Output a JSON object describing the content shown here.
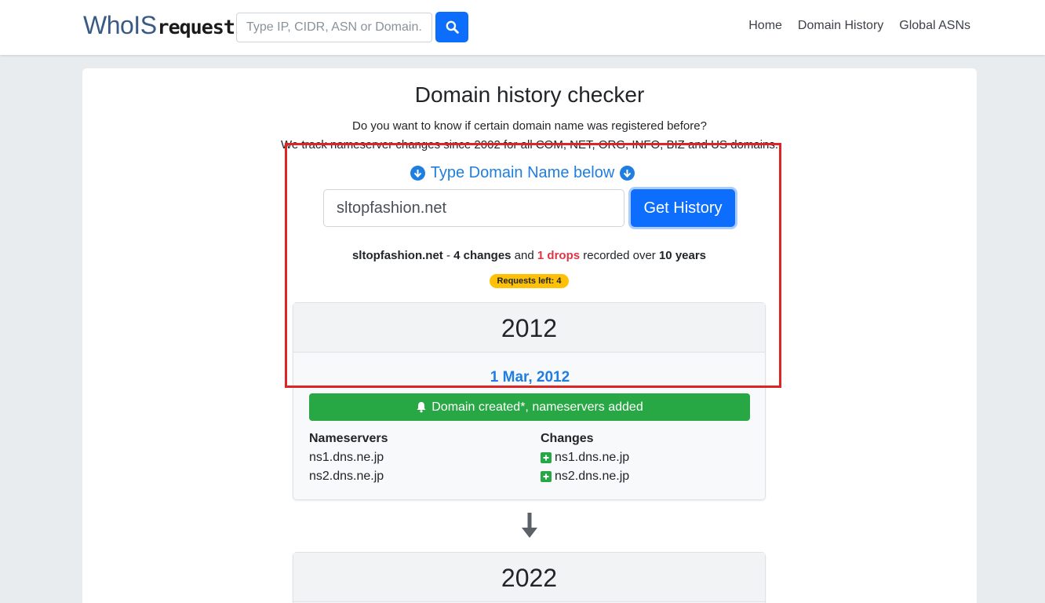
{
  "header": {
    "logo_who": "WhoIS",
    "logo_request": "request",
    "search_placeholder": "Type IP, CIDR, ASN or Domain..",
    "nav": [
      "Home",
      "Domain History",
      "Global ASNs"
    ]
  },
  "page": {
    "title": "Domain history checker",
    "lead_line1": "Do you want to know if certain domain name was registered before?",
    "lead_line2": "We track nameserver changes since 2002 for all COM, NET, ORG, INFO, BIZ and US domains.",
    "type_label": "Type Domain Name below",
    "domain_value": "sltopfashion.net",
    "get_history_label": "Get History"
  },
  "summary": {
    "domain": "sltopfashion.net",
    "sep": " - ",
    "changes": "4 changes",
    "and": " and ",
    "drops": "1 drops",
    "recorded": " recorded over ",
    "years": "10 years",
    "requests_left": "Requests left: 4"
  },
  "history": [
    {
      "year": "2012",
      "date": "1 Mar, 2012",
      "event": "Domain created*, nameservers added",
      "nameservers_heading": "Nameservers",
      "changes_heading": "Changes",
      "nameservers": [
        "ns1.dns.ne.jp",
        "ns2.dns.ne.jp"
      ],
      "changes": [
        "ns1.dns.ne.jp",
        "ns2.dns.ne.jp"
      ]
    },
    {
      "year": "2022"
    }
  ],
  "colors": {
    "primary": "#0d6efd",
    "link_blue": "#1f7ee0",
    "success": "#28a745",
    "danger": "#dc3545",
    "warning": "#ffc107",
    "highlight": "#dc2626"
  },
  "icons": {
    "search": "search-icon",
    "arrow_circle": "arrow-circle-down-icon",
    "bell": "bell-icon",
    "plus": "plus-square-icon",
    "arrow_down": "arrow-down-icon"
  }
}
